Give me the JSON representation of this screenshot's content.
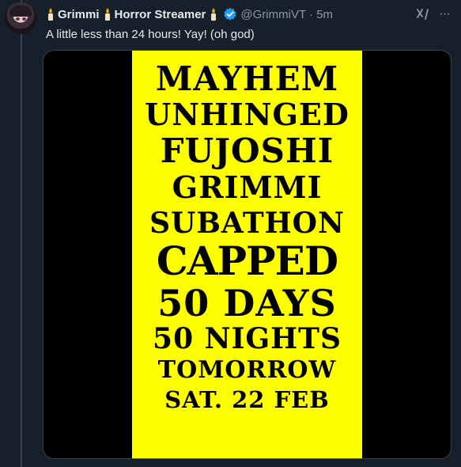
{
  "tweet": {
    "display_name_parts": [
      "Grimmi",
      "Horror Streamer"
    ],
    "handle": "@GrimmiVT",
    "separator": "·",
    "time": "5m",
    "text": "A little less than 24 hours! Yay! (oh god)",
    "more_glyph": "···"
  },
  "icons": {
    "avatar": "avatar-image",
    "candle": "candle-emoji-icon",
    "verified": "verified-badge-icon",
    "grok": "grok-icon",
    "more": "more-options-icon"
  },
  "colors": {
    "background": "#15202b",
    "text_primary": "#e7e9ea",
    "text_secondary": "#8b98a5",
    "verified_blue": "#1d9bf0",
    "poster_yellow": "#ffff00"
  },
  "poster": {
    "lines": [
      "MAYHEM",
      "UNHINGED",
      "FUJOSHI",
      "GRIMMI",
      "SUBATHON",
      "CAPPED",
      "50 DAYS",
      "50 NIGHTS",
      "TOMORROW",
      "SAT. 22 FEB"
    ]
  }
}
